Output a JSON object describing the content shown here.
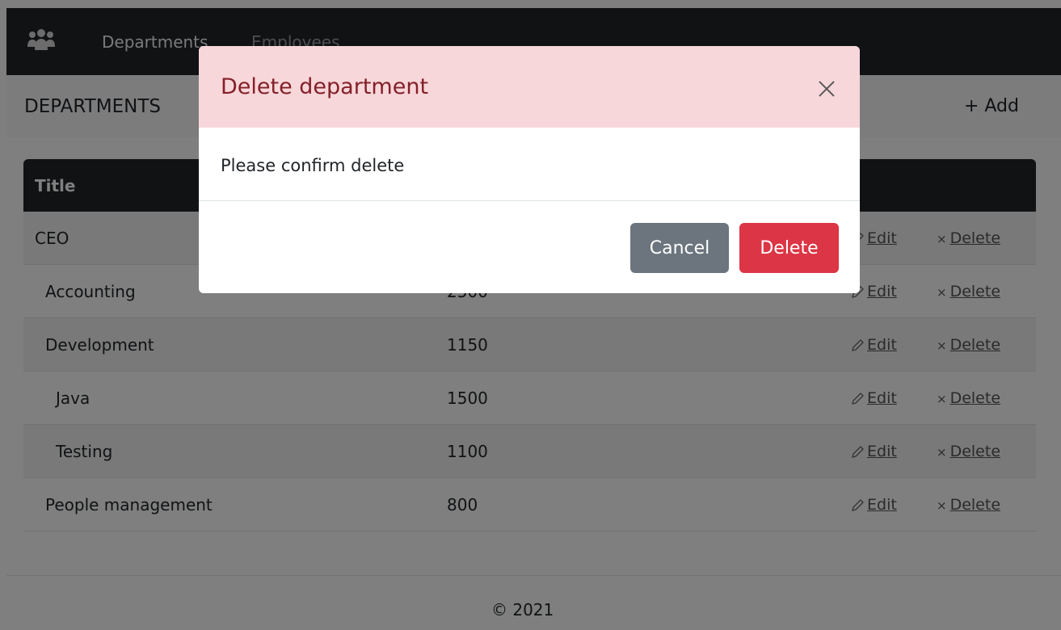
{
  "nav": {
    "brand_icon": "users-icon",
    "links": [
      "Departments",
      "Employees"
    ]
  },
  "header": {
    "title": "DEPARTMENTS",
    "add_label": "+ Add"
  },
  "table": {
    "columns": [
      "Title"
    ],
    "rows": [
      {
        "title": "CEO",
        "value": ""
      },
      {
        "title": "Accounting",
        "value": "2500"
      },
      {
        "title": "Development",
        "value": "1150"
      },
      {
        "title": "Java",
        "value": "1500"
      },
      {
        "title": "Testing",
        "value": "1100"
      },
      {
        "title": "People management",
        "value": "800"
      }
    ],
    "edit_label": "Edit",
    "delete_label": "Delete",
    "edit_icon": "pencil-icon",
    "delete_icon": "x-icon"
  },
  "footer": {
    "text": "© 2021"
  },
  "modal": {
    "title": "Delete department",
    "body": "Please confirm delete",
    "cancel_label": "Cancel",
    "delete_label": "Delete",
    "close_icon": "close-icon"
  },
  "colors": {
    "navbar": "#212529",
    "modal_header": "#f8d7da",
    "modal_title": "#842029",
    "cancel": "#6c757d",
    "danger": "#dc3545"
  }
}
